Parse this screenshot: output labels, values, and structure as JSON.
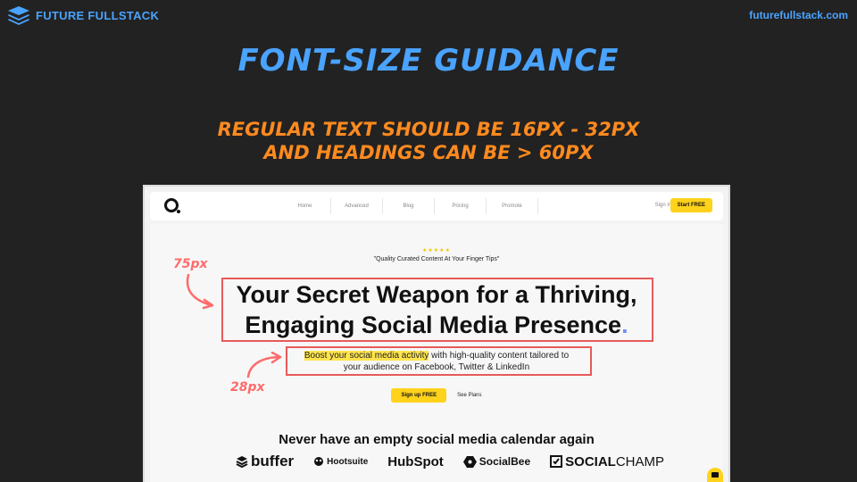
{
  "header": {
    "brand": "FUTURE FULLSTACK",
    "url": "futurefullstack.com"
  },
  "slide": {
    "title": "FONT-SIZE GUIDANCE",
    "subtitle_line1": "REGULAR TEXT SHOULD BE 16PX - 32PX",
    "subtitle_line2": "AND HEADINGS CAN BE > 60PX"
  },
  "annotations": {
    "heading_size": "75px",
    "body_size": "28px"
  },
  "screenshot": {
    "nav": {
      "links": [
        "Home",
        "Advanced",
        "Blog",
        "Pricing",
        "Promote"
      ],
      "signin": "Sign in",
      "start": "Start FREE"
    },
    "hero": {
      "stars": "★★★★★",
      "quote": "\"Quality Curated Content At Your Finger Tips\"",
      "headline_line1": "Your Secret Weapon for a Thriving,",
      "headline_line2": "Engaging Social Media Presence",
      "headline_dot": ".",
      "desc_highlight": "Boost your social media activity",
      "desc_rest": " with high-quality content tailored to",
      "desc_line2": "your audience on Facebook, Twitter & LinkedIn",
      "signup_prefix": "Sign up ",
      "signup_bold": "FREE",
      "see_plans": "See Plans",
      "never": "Never have an empty social media calendar again"
    },
    "logos": {
      "buffer": "buffer",
      "hootsuite": "Hootsuite",
      "hubspot": "HubSpot",
      "socialbee": "SocialBee",
      "socialchamp_bold": "SOCIAL",
      "socialchamp_rest": "CHAMP"
    }
  },
  "colors": {
    "accent_blue": "#4aa3ff",
    "accent_orange": "#ff8a1f",
    "annotation_red": "#e85a5a",
    "cta_yellow": "#ffd21c"
  }
}
